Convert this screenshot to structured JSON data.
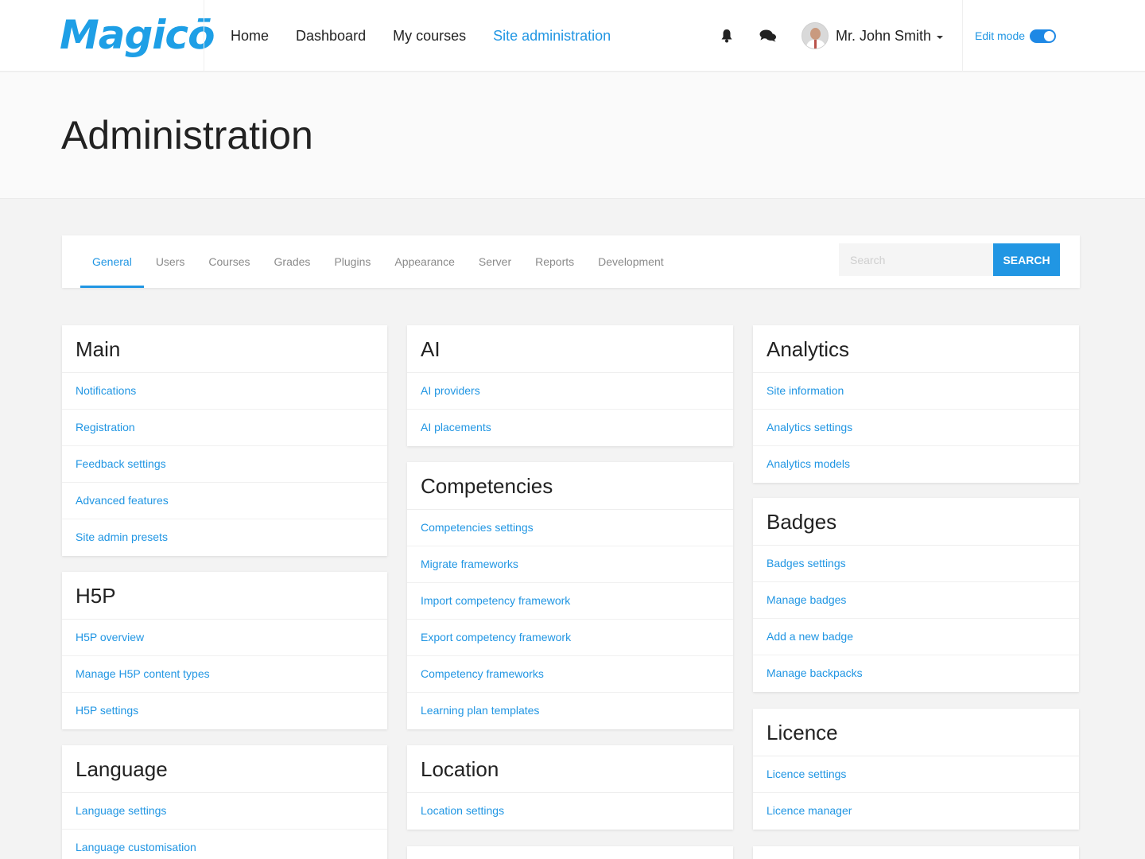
{
  "brand": {
    "logo_text": "Magicō",
    "accent": "#2196e3"
  },
  "nav": {
    "items": [
      {
        "label": "Home",
        "active": false
      },
      {
        "label": "Dashboard",
        "active": false
      },
      {
        "label": "My courses",
        "active": false
      },
      {
        "label": "Site administration",
        "active": true
      }
    ]
  },
  "header": {
    "icons": [
      "bell-icon",
      "chat-icon"
    ],
    "user": {
      "name": "Mr. John Smith"
    },
    "edit_mode": {
      "label": "Edit mode",
      "on": true
    }
  },
  "page": {
    "title": "Administration"
  },
  "tabs": {
    "items": [
      {
        "label": "General",
        "active": true
      },
      {
        "label": "Users"
      },
      {
        "label": "Courses"
      },
      {
        "label": "Grades"
      },
      {
        "label": "Plugins"
      },
      {
        "label": "Appearance"
      },
      {
        "label": "Server"
      },
      {
        "label": "Reports"
      },
      {
        "label": "Development"
      }
    ],
    "search": {
      "placeholder": "Search",
      "button": "SEARCH"
    }
  },
  "sections": {
    "main": {
      "title": "Main",
      "links": [
        "Notifications",
        "Registration",
        "Feedback settings",
        "Advanced features",
        "Site admin presets"
      ]
    },
    "h5p": {
      "title": "H5P",
      "links": [
        "H5P overview",
        "Manage H5P content types",
        "H5P settings"
      ]
    },
    "language": {
      "title": "Language",
      "links": [
        "Language settings",
        "Language customisation"
      ]
    },
    "ai": {
      "title": "AI",
      "links": [
        "AI providers",
        "AI placements"
      ]
    },
    "competencies": {
      "title": "Competencies",
      "links": [
        "Competencies settings",
        "Migrate frameworks",
        "Import competency framework",
        "Export competency framework",
        "Competency frameworks",
        "Learning plan templates"
      ]
    },
    "location": {
      "title": "Location",
      "links": [
        "Location settings"
      ]
    },
    "analytics": {
      "title": "Analytics",
      "links": [
        "Site information",
        "Analytics settings",
        "Analytics models"
      ]
    },
    "badges": {
      "title": "Badges",
      "links": [
        "Badges settings",
        "Manage badges",
        "Add a new badge",
        "Manage backpacks"
      ]
    },
    "licence": {
      "title": "Licence",
      "links": [
        "Licence settings",
        "Licence manager"
      ]
    }
  }
}
